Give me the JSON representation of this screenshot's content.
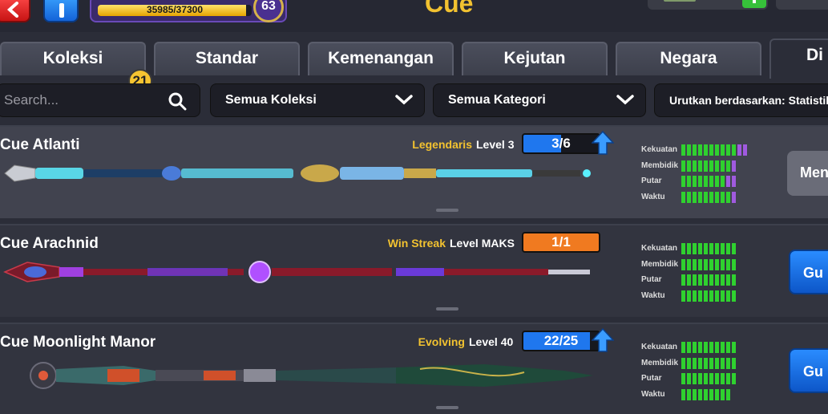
{
  "header": {
    "title": "Cue",
    "xp_text": "35985/37300",
    "xp_fraction": 0.965,
    "player_level": "63"
  },
  "tabs": [
    {
      "label": "Koleksi",
      "badge": "21"
    },
    {
      "label": "Standar"
    },
    {
      "label": "Kemenangan"
    },
    {
      "label": "Kejutan"
    },
    {
      "label": "Negara"
    },
    {
      "label": "Di"
    }
  ],
  "filters": {
    "search_placeholder": "Search...",
    "collection_label": "Semua Koleksi",
    "category_label": "Semua Kategori",
    "sort_label": "Urutkan berdasarkan: Statistik"
  },
  "stat_labels": {
    "power": "Kekuatan",
    "aim": "Membidik",
    "spin": "Putar",
    "time": "Waktu"
  },
  "cues": [
    {
      "name": "Cue Atlanti",
      "rarity": "Legendaris",
      "rarity_color": "#f2c230",
      "level_text": "Level 3",
      "progress_text": "3/6",
      "progress_fraction": 0.5,
      "progress_color": "#1f77ee",
      "upgrade_available": true,
      "stats": {
        "power": [
          10,
          2
        ],
        "aim": [
          9,
          1
        ],
        "spin": [
          8,
          2
        ],
        "time": [
          9,
          1
        ]
      },
      "action_label": "Meng",
      "action_style": "grey"
    },
    {
      "name": "Cue Arachnid",
      "rarity": "Win Streak",
      "rarity_color": "#f2c230",
      "level_text": "Level MAKS",
      "progress_text": "1/1",
      "progress_fraction": 1.0,
      "progress_color": "#f07a20",
      "upgrade_available": false,
      "stats": {
        "power": [
          10,
          0
        ],
        "aim": [
          10,
          0
        ],
        "spin": [
          10,
          0
        ],
        "time": [
          10,
          0
        ]
      },
      "action_label": "Gu",
      "action_style": "blue"
    },
    {
      "name": "Cue Moonlight Manor",
      "rarity": "Evolving",
      "rarity_color": "#f2c230",
      "level_text": "Level 40",
      "progress_text": "22/25",
      "progress_fraction": 0.88,
      "progress_color": "#1f77ee",
      "upgrade_available": true,
      "stats": {
        "power": [
          10,
          0
        ],
        "aim": [
          10,
          0
        ],
        "spin": [
          10,
          0
        ],
        "time": [
          9,
          0
        ]
      },
      "action_label": "Gu",
      "action_style": "blue"
    }
  ],
  "colors": {
    "stat_green": "#2fd12f",
    "stat_purple": "#a05adf",
    "accent_gold": "#f2c230"
  }
}
